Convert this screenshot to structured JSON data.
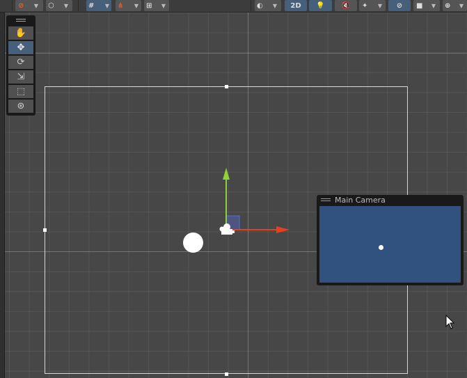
{
  "toolbar": {
    "mode_2d_label": "2D",
    "buttons": [
      "gizmo-toggle",
      "object-view",
      "grid-snap",
      "snap-increment",
      "grid-visibility",
      "shading-mode",
      "2d-mode",
      "lighting",
      "audio-mute",
      "effects",
      "hidden-objects",
      "camera-settings",
      "gizmos"
    ]
  },
  "tools": {
    "items": [
      "hand-tool",
      "move-tool",
      "rotate-tool",
      "scale-tool",
      "rect-tool",
      "transform-tool"
    ],
    "active": "move-tool"
  },
  "camera_preview": {
    "title": "Main Camera"
  },
  "colors": {
    "accent": "#46607c",
    "camera_bg": "#31517e",
    "x_axis": "#e8401c",
    "y_axis": "#8fd33b"
  }
}
